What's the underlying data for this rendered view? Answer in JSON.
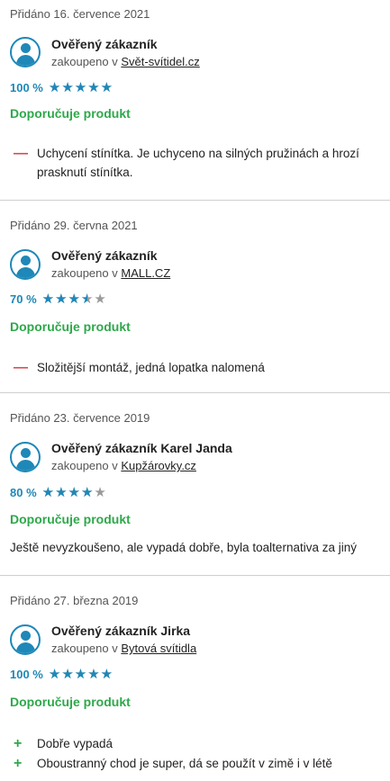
{
  "reviews": [
    {
      "date": "Přidáno 16. července 2021",
      "author": "Ověřený zákazník",
      "bought_prefix": "zakoupeno v",
      "shop": "Svět-svítidel.cz",
      "rating_label": "100 %",
      "rating_fraction": 1.0,
      "recommend": "Doporučuje produkt",
      "cons": [
        "Uchycení stínítka. Je uchyceno na silných pružinách a hrozí prasknutí stínítka."
      ]
    },
    {
      "date": "Přidáno 29. června 2021",
      "author": "Ověřený zákazník",
      "bought_prefix": "zakoupeno v",
      "shop": "MALL.CZ",
      "rating_label": "70 %",
      "rating_fraction": 0.7,
      "recommend": "Doporučuje produkt",
      "cons": [
        "Složitější montáž, jedná lopatka nalomená"
      ]
    },
    {
      "date": "Přidáno 23. července 2019",
      "author": "Ověřený zákazník Karel Janda",
      "bought_prefix": "zakoupeno v",
      "shop": "Kupžárovky.cz",
      "rating_label": "80 %",
      "rating_fraction": 0.8,
      "recommend": "Doporučuje produkt",
      "text": "Ještě nevyzkoušeno, ale vypadá dobře, byla toalternativa za jiný"
    },
    {
      "date": "Přidáno 27. března 2019",
      "author": "Ověřený zákazník Jirka",
      "bought_prefix": "zakoupeno v",
      "shop": "Bytová svítidla",
      "rating_label": "100 %",
      "rating_fraction": 1.0,
      "recommend": "Doporučuje produkt",
      "pros": [
        "Dobře vypadá",
        "Oboustranný chod je super, dá se použít v zimě i v létě"
      ]
    }
  ],
  "icons": {
    "avatar": "user-avatar-icon",
    "star": "star-icon",
    "minus": "minus-icon",
    "plus": "plus-icon"
  },
  "colors": {
    "accent": "#1e88b8",
    "positive": "#2ea84a",
    "negative": "#d9464c",
    "star_empty": "#9a9a9a"
  }
}
